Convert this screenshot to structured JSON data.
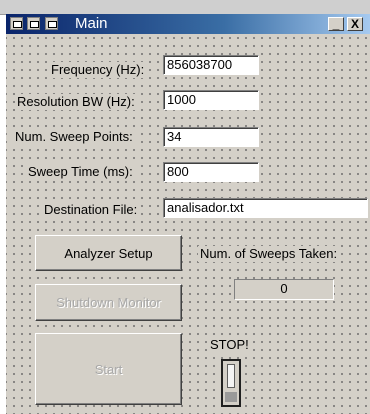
{
  "window": {
    "title": "Main",
    "minimize_label": "_",
    "close_label": "X"
  },
  "controls": {
    "frequency": {
      "label": "Frequency (Hz):",
      "value": "856038700"
    },
    "resolution_bw": {
      "label": "Resolution BW (Hz):",
      "value": "1000"
    },
    "sweep_points": {
      "label": "Num. Sweep Points:",
      "value": "34"
    },
    "sweep_time": {
      "label": "Sweep Time (ms):",
      "value": "800"
    },
    "destination_file": {
      "label": "Destination File:",
      "value": "analisador.txt"
    }
  },
  "buttons": {
    "analyzer_setup": "Analyzer Setup",
    "shutdown_monitor": "Shutdown Monitor",
    "start": "Start"
  },
  "sweeps": {
    "label": "Num. of Sweeps Taken:",
    "value": "0"
  },
  "stop": {
    "label": "STOP!"
  }
}
